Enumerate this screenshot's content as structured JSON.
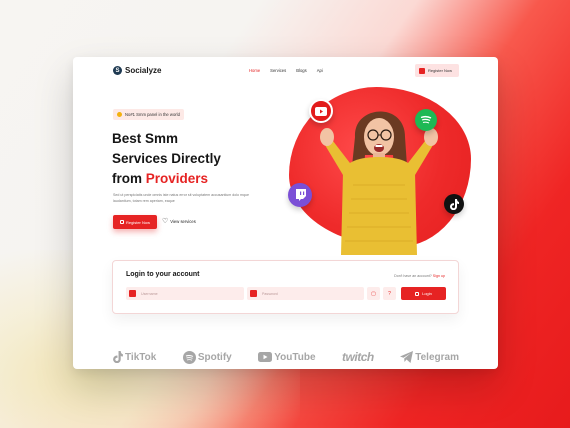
{
  "brand": {
    "name": "Socialyze",
    "logo_letter": "S"
  },
  "nav": {
    "items": [
      {
        "label": "Home",
        "active": true
      },
      {
        "label": "Services",
        "active": false
      },
      {
        "label": "Blogs",
        "active": false
      },
      {
        "label": "Api",
        "active": false
      }
    ],
    "register_label": "Register Now"
  },
  "hero": {
    "badge": "No#1 Smm panel in the world",
    "headline_line1": "Best Smm",
    "headline_line2": "Services Directly",
    "headline_line3_prefix": "from",
    "headline_line3_highlight": "Providers",
    "description": "Sed ut perspiciatis unde omnis iste natus error sit voluptatem accusantium dolo mque laudantium, totam rem aperiam, eaque",
    "cta_label": "Register Now",
    "secondary_label": "View services"
  },
  "login": {
    "title": "Login to your account",
    "signup_prompt": "Don't have an account?",
    "signup_link": "Sign up",
    "username_placeholder": "Username",
    "password_placeholder": "Password",
    "help_glyph": "?",
    "login_label": "Login"
  },
  "platforms": [
    {
      "name": "TikTok",
      "icon": "tiktok-icon"
    },
    {
      "name": "Spotify",
      "icon": "spotify-icon"
    },
    {
      "name": "YouTube",
      "icon": "youtube-icon"
    },
    {
      "name": "twitch",
      "icon": "twitch-icon"
    },
    {
      "name": "Telegram",
      "icon": "telegram-icon"
    }
  ],
  "colors": {
    "accent": "#e62323",
    "text": "#161616",
    "muted": "#a6a6a6"
  }
}
